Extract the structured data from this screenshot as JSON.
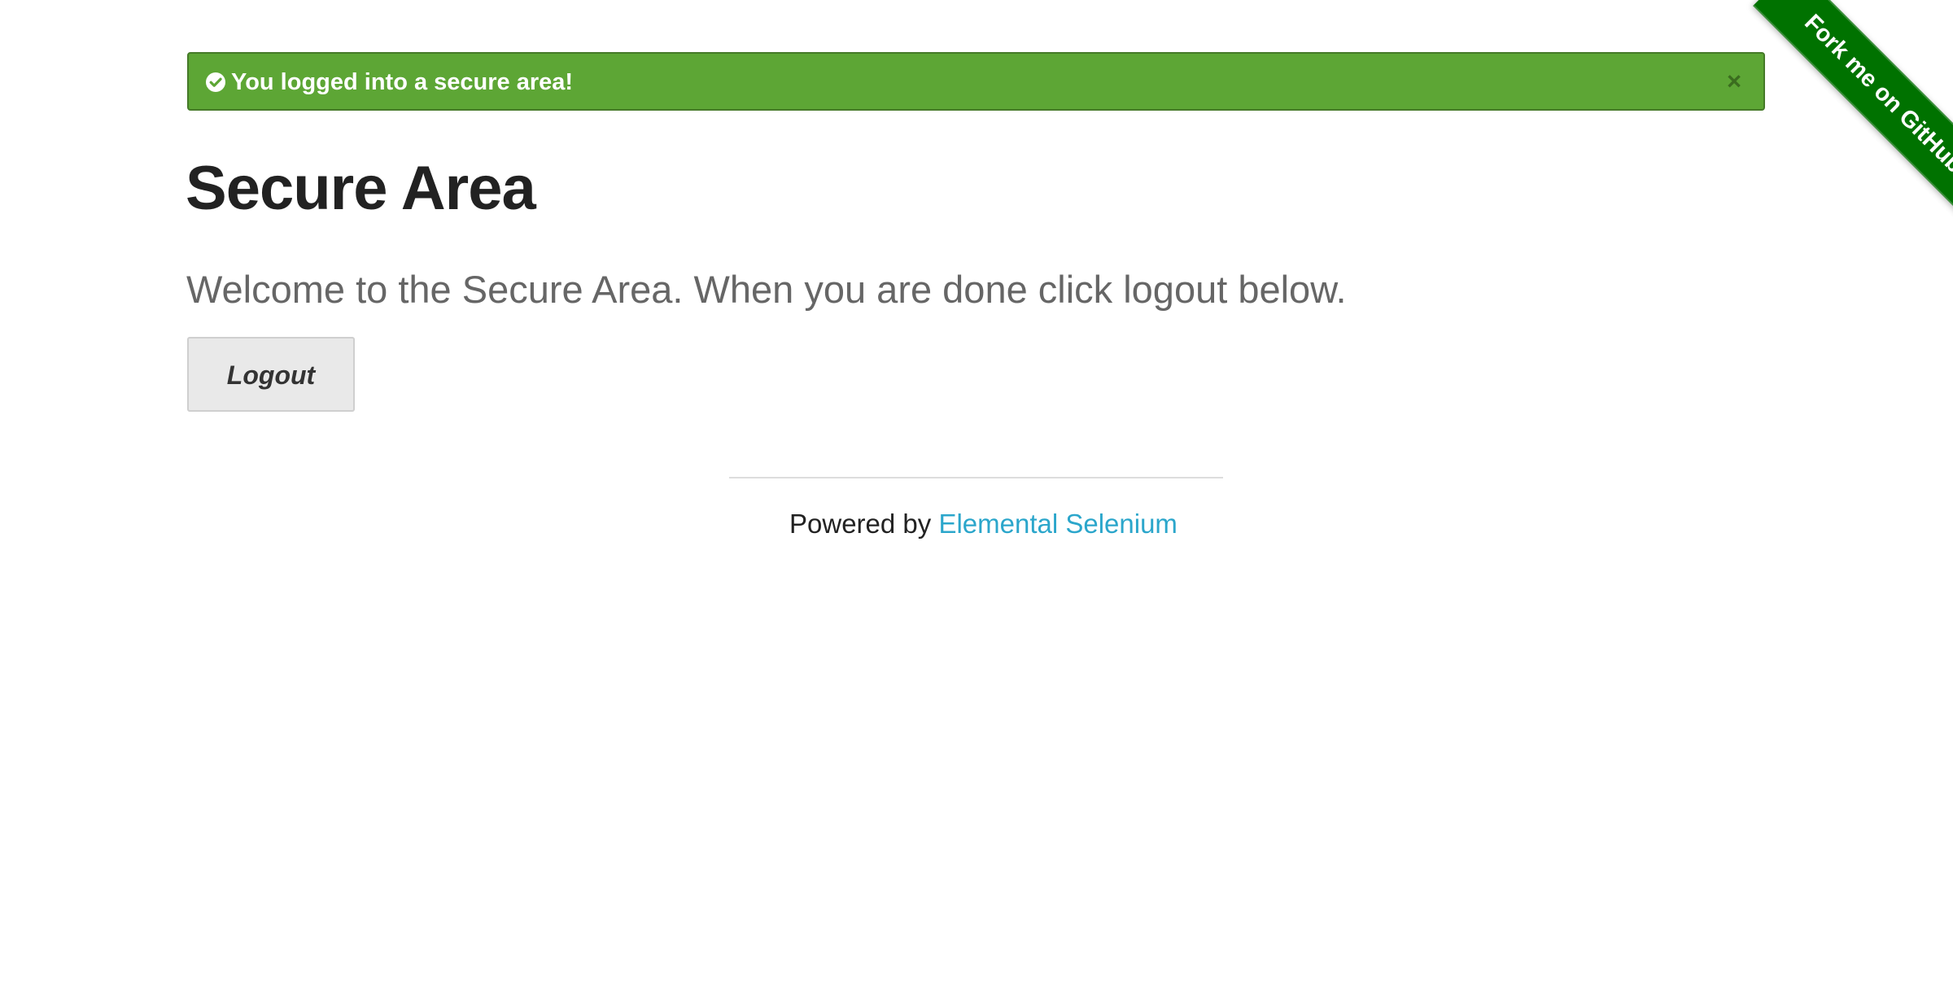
{
  "flash": {
    "message": "You logged into a secure area!",
    "icon": "check-circle-icon",
    "close_label": "×",
    "background_color": "#5da635"
  },
  "main": {
    "title": "Secure Area",
    "subheader": "Welcome to the Secure Area. When you are done click logout below.",
    "logout_label": "Logout"
  },
  "footer": {
    "prefix": "Powered by ",
    "link_text": "Elemental Selenium",
    "link_color": "#2ba6cb"
  },
  "github_ribbon": {
    "label": "Fork me on GitHub",
    "color": "#007200"
  }
}
